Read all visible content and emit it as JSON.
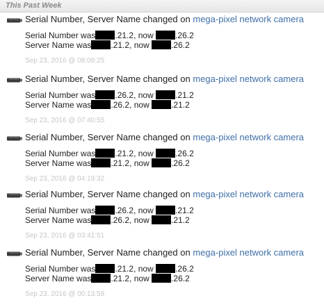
{
  "section": {
    "title": "This Past Week"
  },
  "events": [
    {
      "title": "Serial Number, Server Name changed on",
      "device": "mega-pixel network camera",
      "serial_prefix": "Serial Number was",
      "serial_old_suffix": ".21.2, now",
      "serial_new_suffix": ".26.2",
      "server_prefix": "Server Name was",
      "server_old_suffix": ".21.2, now",
      "server_new_suffix": ".26.2",
      "timestamp": "Sep 23, 2016 @ 08:09:25"
    },
    {
      "title": "Serial Number, Server Name changed on",
      "device": "mega-pixel network camera",
      "serial_prefix": "Serial Number was",
      "serial_old_suffix": ".26.2, now",
      "serial_new_suffix": ".21.2",
      "server_prefix": "Server Name was",
      "server_old_suffix": ".26.2, now",
      "server_new_suffix": ".21.2",
      "timestamp": "Sep 23, 2016 @ 07:40:55"
    },
    {
      "title": "Serial Number, Server Name changed on",
      "device": "mega-pixel network camera",
      "serial_prefix": "Serial Number was",
      "serial_old_suffix": ".21.2, now",
      "serial_new_suffix": ".26.2",
      "server_prefix": "Server Name was",
      "server_old_suffix": ".21.2, now",
      "server_new_suffix": ".26.2",
      "timestamp": "Sep 23, 2016 @ 04:19:32"
    },
    {
      "title": "Serial Number, Server Name changed on",
      "device": "mega-pixel network camera",
      "serial_prefix": "Serial Number was",
      "serial_old_suffix": ".26.2, now",
      "serial_new_suffix": ".21.2",
      "server_prefix": "Server Name was",
      "server_old_suffix": ".26.2, now",
      "server_new_suffix": ".21.2",
      "timestamp": "Sep 23, 2016 @ 03:41:51"
    },
    {
      "title": "Serial Number, Server Name changed on",
      "device": "mega-pixel network camera",
      "serial_prefix": "Serial Number was",
      "serial_old_suffix": ".21.2, now",
      "serial_new_suffix": ".26.2",
      "server_prefix": "Server Name was",
      "server_old_suffix": ".21.2, now",
      "server_new_suffix": ".26.2",
      "timestamp": "Sep 23, 2016 @ 00:13:58"
    }
  ],
  "icons": {
    "event_icon": "network-camera-icon"
  },
  "colors": {
    "link": "#3f6fa8",
    "timestamp": "#c6c6c6",
    "redaction": "#000000"
  }
}
